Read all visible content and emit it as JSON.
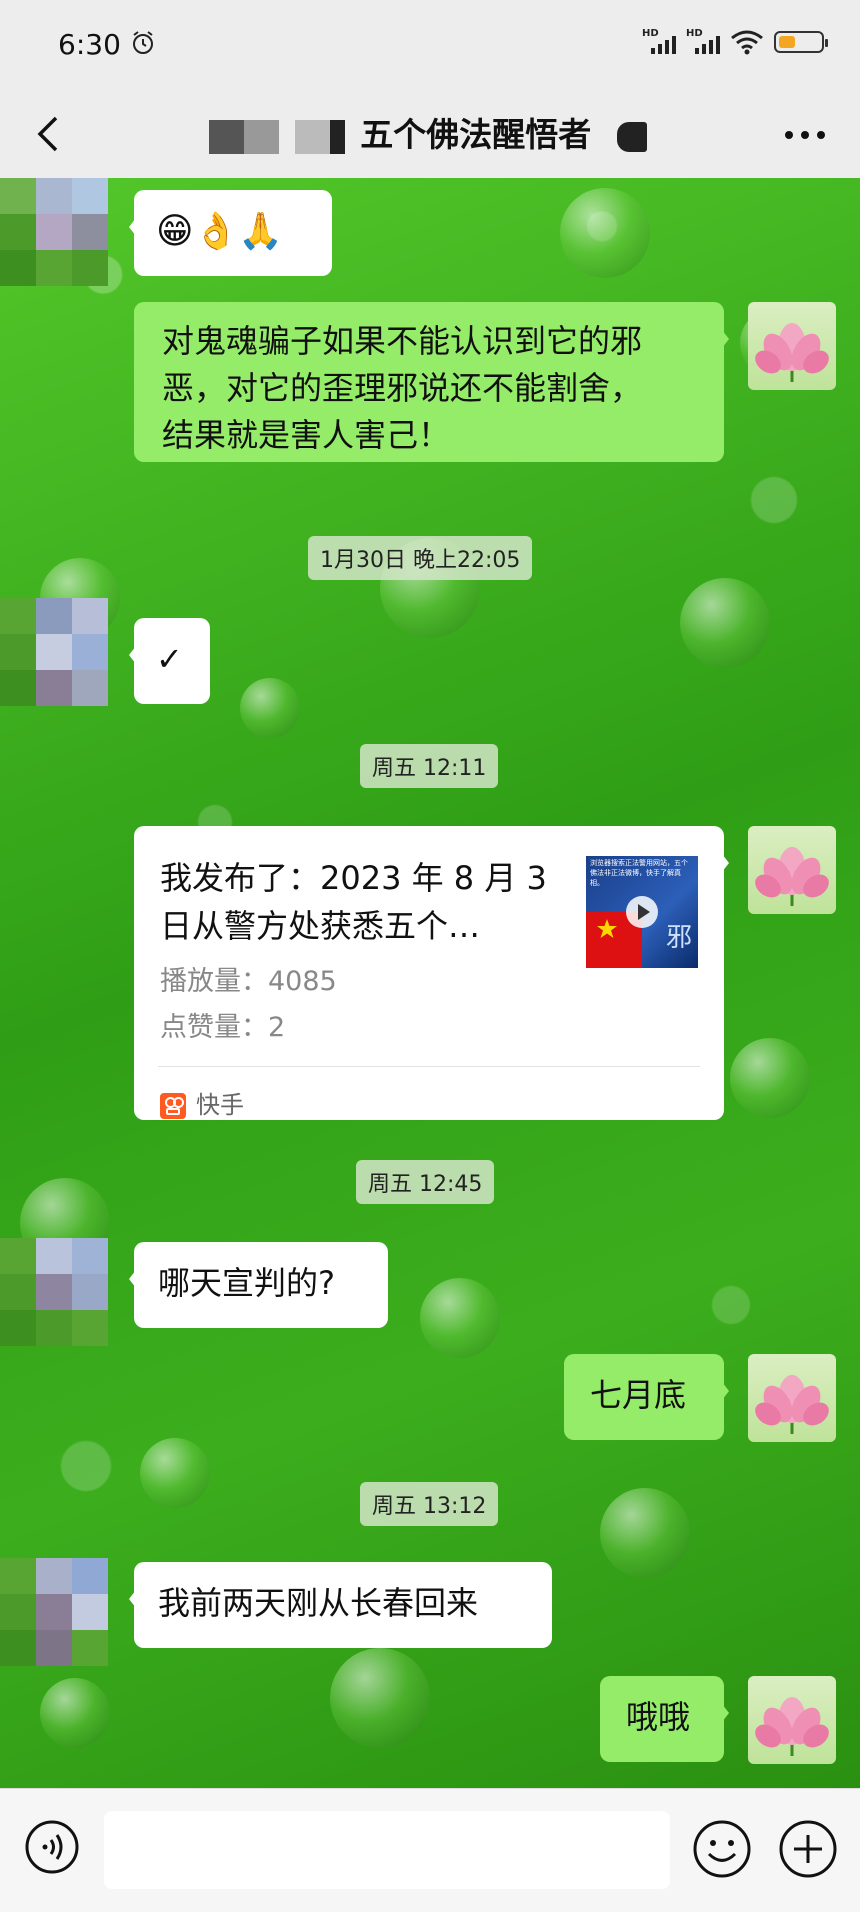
{
  "status_bar": {
    "time": "6:30",
    "signal_label": "HD",
    "battery_level": 0.4
  },
  "header": {
    "title": "五个佛法醒悟者",
    "back_icon": "chevron-left-icon",
    "more_icon": "more-horizontal-icon"
  },
  "messages": [
    {
      "side": "left",
      "type": "emoji",
      "text": "😁👌🙏"
    },
    {
      "side": "right",
      "type": "text",
      "lines": [
        "对鬼魂骗子如果不能认识到它的邪",
        "恶，对它的歪理邪说还不能割舍，",
        "结果就是害人害己！"
      ]
    },
    {
      "type": "timestamp",
      "text": "1月30日 晚上22:05"
    },
    {
      "side": "left",
      "type": "text",
      "text": "✓"
    },
    {
      "type": "timestamp",
      "text": "周五 12:11"
    },
    {
      "side": "right",
      "type": "link_card",
      "title_lines": [
        "我发布了：2023 年 8 月 3",
        "日从警方处获悉五个…"
      ],
      "plays": "播放量：4085",
      "likes": "点赞量：2",
      "source": "快手",
      "thumb_caption": "浏览器搜索正法警用网站，五个佛法非正法微博，快手了解真相。",
      "thumb_mark": "邪"
    },
    {
      "type": "timestamp",
      "text": "周五 12:45"
    },
    {
      "side": "left",
      "type": "text",
      "text": "哪天宣判的?"
    },
    {
      "side": "right",
      "type": "text",
      "text": "七月底"
    },
    {
      "type": "timestamp",
      "text": "周五 13:12"
    },
    {
      "side": "left",
      "type": "text",
      "text": "我前两天刚从长春回来"
    },
    {
      "side": "right",
      "type": "text",
      "text": "哦哦"
    }
  ],
  "input_bar": {
    "placeholder": "",
    "voice_icon": "voice-icon",
    "emoji_icon": "emoji-icon",
    "plus_icon": "plus-icon"
  },
  "colors": {
    "green_bubble": "#95ec69",
    "white_bubble": "#ffffff",
    "battery": "#f4a622",
    "kuaishou": "#ff5a1f"
  }
}
